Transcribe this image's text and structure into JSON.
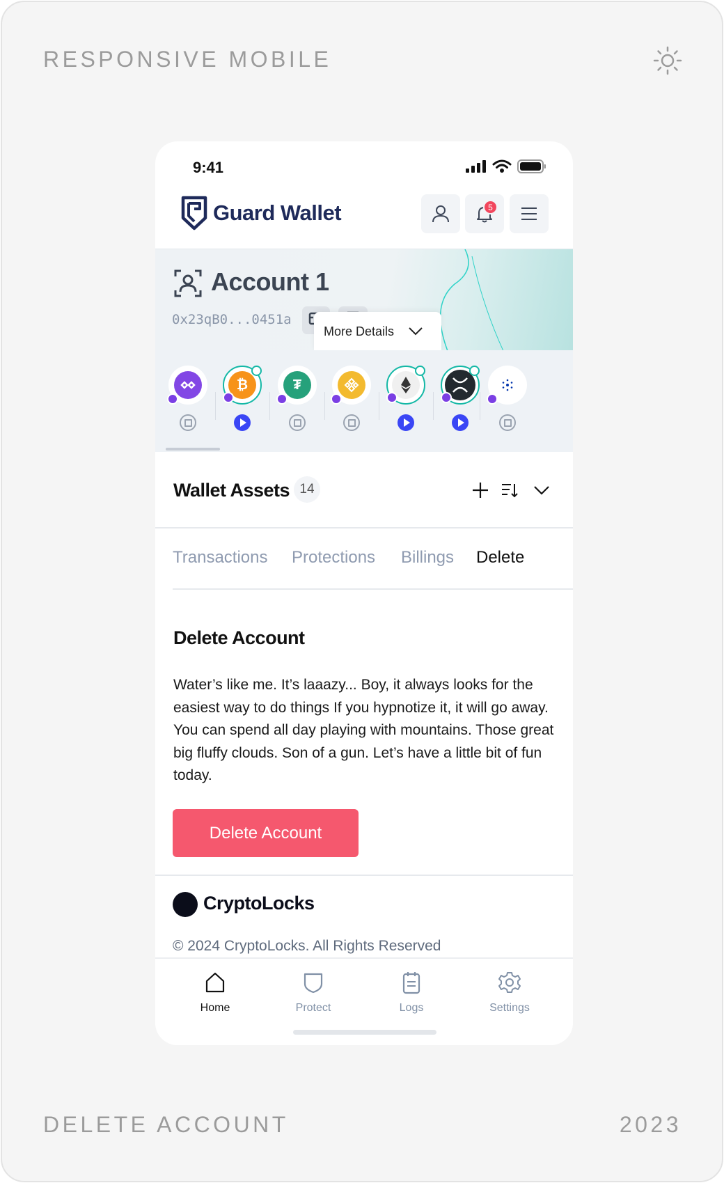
{
  "frame": {
    "top_label": "RESPONSIVE MOBILE",
    "bottom_label": "DELETE ACCOUNT",
    "year": "2023",
    "theme_icon": "sun-icon"
  },
  "status_bar": {
    "time": "9:41"
  },
  "header": {
    "app_name": "Guard Wallet",
    "notification_count": "5",
    "icons": [
      "user-icon",
      "bell-icon",
      "menu-icon"
    ]
  },
  "account": {
    "name": "Account 1",
    "address": "0x23qB0...0451a",
    "more_details": "More Details"
  },
  "coins": [
    {
      "name": "polygon",
      "color": "#8247e5",
      "active": false,
      "checked": false,
      "control": "stop"
    },
    {
      "name": "bitcoin",
      "color": "#f7931a",
      "active": true,
      "checked": true,
      "control": "play"
    },
    {
      "name": "tether",
      "color": "#26a17b",
      "active": false,
      "checked": false,
      "control": "stop"
    },
    {
      "name": "binance",
      "color": "#f3ba2f",
      "active": false,
      "checked": false,
      "control": "stop"
    },
    {
      "name": "ethereum",
      "color": "#343434",
      "active": true,
      "checked": true,
      "control": "play"
    },
    {
      "name": "xrp",
      "color": "#23292f",
      "active": true,
      "checked": true,
      "control": "play"
    },
    {
      "name": "cardano",
      "color": "#0033ad",
      "active": false,
      "checked": false,
      "control": "stop"
    }
  ],
  "assets": {
    "title": "Wallet Assets",
    "count": "14"
  },
  "tabs": [
    {
      "label": "Transactions",
      "active": false
    },
    {
      "label": "Protections",
      "active": false
    },
    {
      "label": "Billings",
      "active": false
    },
    {
      "label": "Delete",
      "active": true
    }
  ],
  "delete_section": {
    "title": "Delete Account",
    "body": "Water’s like me. It’s laaazy... Boy, it always looks for the easiest way to do things If you hypnotize it, it will go away. You can spend all day playing with mountains. Those great big fluffy clouds. Son of a gun. Let’s have a little bit of fun today.",
    "button_label": "Delete Account",
    "button_color": "#f5586e"
  },
  "footer": {
    "brand": "CryptoLocks",
    "copyright": "© 2024 CryptoLocks. All Rights Reserved"
  },
  "bottom_nav": [
    {
      "label": "Home",
      "icon": "home-icon",
      "active": true
    },
    {
      "label": "Protect",
      "icon": "shield-icon",
      "active": false
    },
    {
      "label": "Logs",
      "icon": "logs-icon",
      "active": false
    },
    {
      "label": "Settings",
      "icon": "gear-icon",
      "active": false
    }
  ]
}
